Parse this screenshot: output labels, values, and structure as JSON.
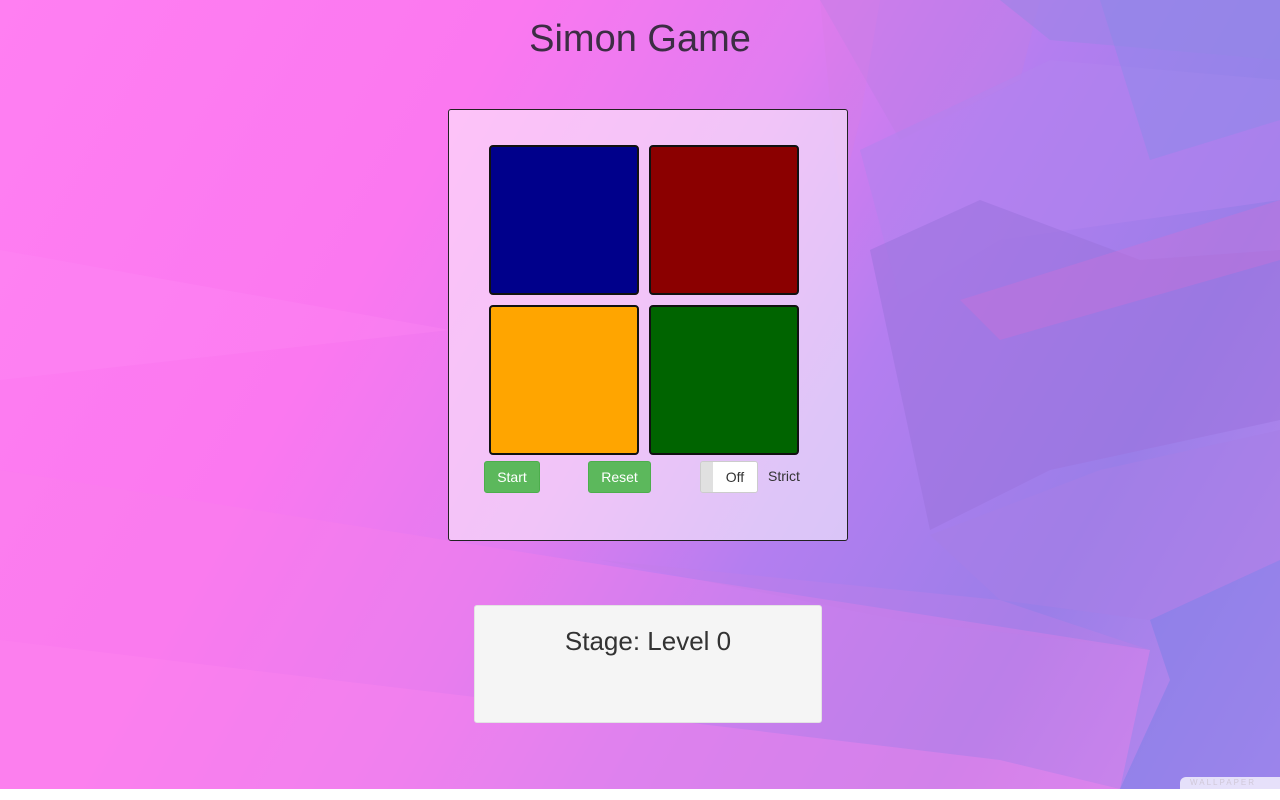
{
  "page": {
    "title": "Simon Game",
    "watermark": "WALLPAPER"
  },
  "board": {
    "pads": [
      {
        "color_name": "blue",
        "hex": "#00008b"
      },
      {
        "color_name": "red",
        "hex": "#8b0000"
      },
      {
        "color_name": "yellow",
        "hex": "#ffa500"
      },
      {
        "color_name": "green",
        "hex": "#006400"
      }
    ],
    "start_label": "Start",
    "reset_label": "Reset",
    "strict_toggle_state": "Off",
    "strict_label": "Strict"
  },
  "stage": {
    "text": "Stage: Level 0"
  },
  "colors": {
    "button_green": "#5cb85c",
    "title_color": "#3c2d44"
  }
}
